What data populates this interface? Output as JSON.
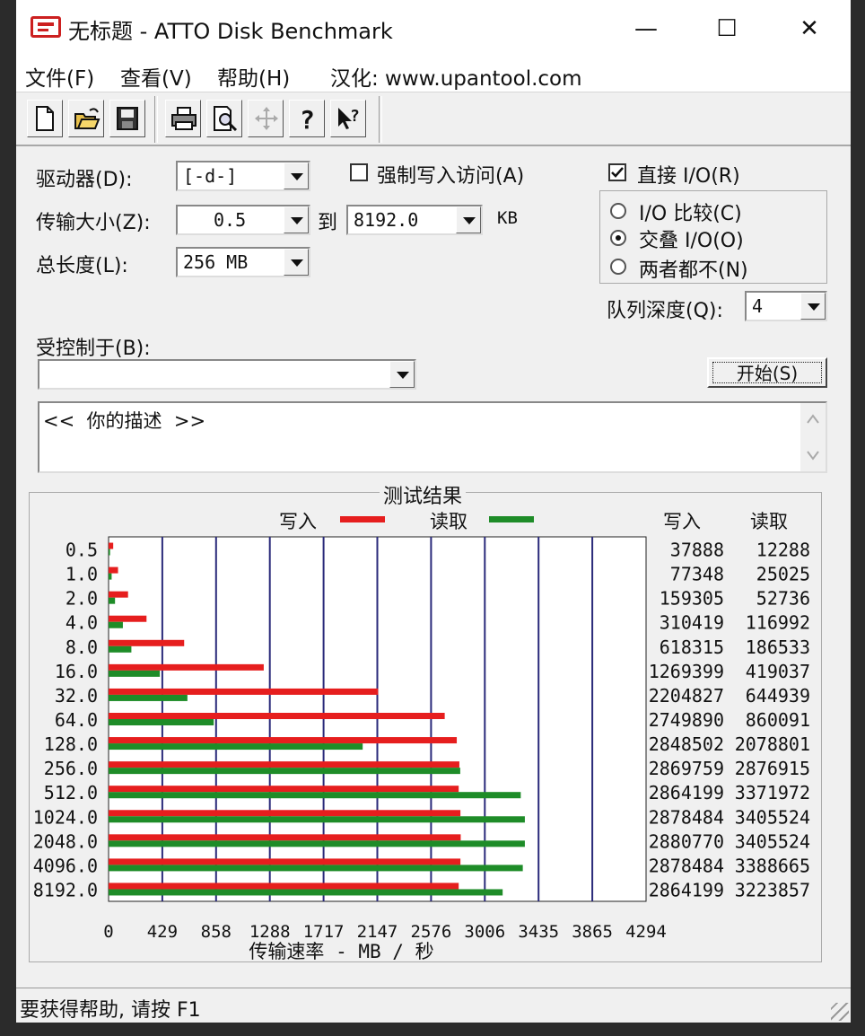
{
  "window": {
    "title": "无标题 - ATTO Disk Benchmark",
    "minimize": "—",
    "maximize": "☐",
    "close": "✕"
  },
  "menu": {
    "file": "文件(F)",
    "view": "查看(V)",
    "help": "帮助(H)",
    "localized": "汉化: www.upantool.com"
  },
  "form": {
    "drive_label": "驱动器(D):",
    "drive_value": "[-d-]",
    "force_write_label": "强制写入访问(A)",
    "direct_io_label": "直接 I/O(R)",
    "transfer_label": "传输大小(Z):",
    "transfer_from": "0.5",
    "to_label": "到",
    "transfer_to": "8192.0",
    "kb_unit": "KB",
    "total_label": "总长度(L):",
    "total_value": "256 MB",
    "io_compare": "I/O 比较(C)",
    "overlap_io": "交叠 I/O(O)",
    "neither": "两者都不(N)",
    "queue_label": "队列深度(Q):",
    "queue_value": "4",
    "controlled_label": "受控制于(B):",
    "controlled_value": "",
    "start_button": "开始(S)",
    "description": "<<  你的描述  >>"
  },
  "colors": {
    "write": "#e61e1e",
    "read": "#1e8c28"
  },
  "chart_data": {
    "type": "bar",
    "title": "测试结果",
    "xlabel": "传输速率 - MB / 秒",
    "xlim": [
      0,
      4294
    ],
    "xticks": [
      "0",
      "429",
      "858",
      "1288",
      "1717",
      "2147",
      "2576",
      "3006",
      "3435",
      "3865",
      "4294"
    ],
    "categories": [
      "0.5",
      "1.0",
      "2.0",
      "4.0",
      "8.0",
      "16.0",
      "32.0",
      "64.0",
      "128.0",
      "256.0",
      "512.0",
      "1024.0",
      "2048.0",
      "4096.0",
      "8192.0"
    ],
    "legend": {
      "write": "写入",
      "read": "读取"
    },
    "table_headers": {
      "write": "写入",
      "read": "读取"
    },
    "series": [
      {
        "name": "写入",
        "values": [
          37888,
          77348,
          159305,
          310419,
          618315,
          1269399,
          2204827,
          2749890,
          2848502,
          2869759,
          2864199,
          2878484,
          2880770,
          2878484,
          2864199
        ]
      },
      {
        "name": "读取",
        "values": [
          12288,
          25025,
          52736,
          116992,
          186533,
          419037,
          644939,
          860091,
          2078801,
          2876915,
          3371972,
          3405524,
          3405524,
          3388665,
          3223857
        ]
      }
    ]
  },
  "status": {
    "text": "要获得帮助, 请按 F1"
  }
}
